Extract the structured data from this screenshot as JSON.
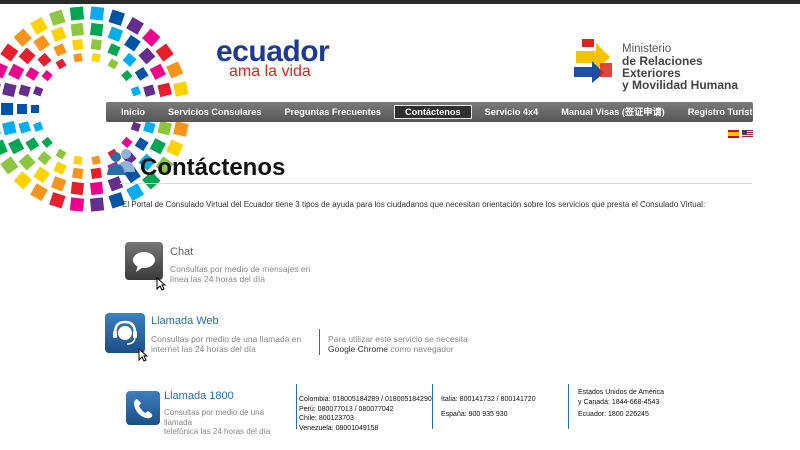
{
  "header": {
    "logo_main": "ecuador",
    "logo_tagline": "ama la vida",
    "ministry_line1": "Ministerio",
    "ministry_line2": "de Relaciones Exteriores",
    "ministry_line3": "y Movilidad Humana"
  },
  "nav": {
    "items": [
      {
        "label": "Inicio"
      },
      {
        "label": "Servicios Consulares"
      },
      {
        "label": "Preguntas Frecuentes"
      },
      {
        "label": "Contáctenos"
      },
      {
        "label": "Servicio 4x4"
      },
      {
        "label": "Manual Visas (签证申请)"
      },
      {
        "label": "Registro Turístico"
      }
    ],
    "active": "Contáctenos"
  },
  "languages": [
    "es-flag-icon",
    "us-flag-icon"
  ],
  "page": {
    "title": "Contáctenos",
    "intro": "El Portal de Consulado Virtual del Ecuador tiene 3 tipos de ayuda para los ciudadanos que necesitan orientación sobre los servicios que presta el Consulado Virtual:"
  },
  "chat": {
    "title": "Chat",
    "desc_line1": "Consultas por medio de mensajes en",
    "desc_line2": "línea las 24 horas del día"
  },
  "web_call": {
    "title": "Llamada Web",
    "desc_line1": "Consultas por medio de una llamada en",
    "desc_line2": "internet las 24 horas del día",
    "note_line1": "Para utilizar este servicio se necesita",
    "note_browser": "Google Chrome",
    "note_suffix": " como navegador"
  },
  "call_1800": {
    "title": "Llamada 1800",
    "desc_line1": "Consultas por medio de una llamada",
    "desc_line2": "telefónica las 24 horas del día",
    "col1": [
      "Colombia: 018005184289 / 018005184290",
      "Perú: 080077013 / 080077042",
      "Chile: 800123703",
      "Venezuela: 08001049158"
    ],
    "col2": [
      "Italia: 800141732  /  800141720",
      "España: 900 935 930"
    ],
    "col3": [
      "Estados Unidos de América",
      "y Canadá: 1844-668-4543",
      "Ecuador: 1800 226245"
    ]
  },
  "colors": {
    "nav_bg": "#5f5f5f",
    "link_blue": "#2a6ea8",
    "logo_blue": "#1f3a93",
    "logo_red": "#d9261c"
  }
}
